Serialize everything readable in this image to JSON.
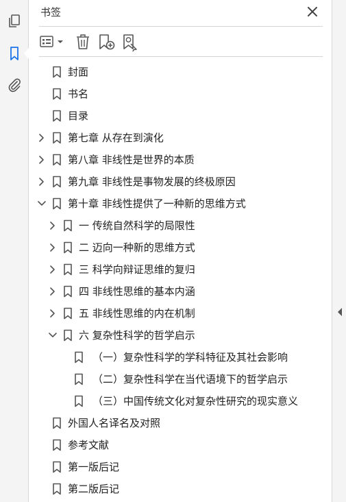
{
  "panel": {
    "title": "书签"
  },
  "rail": {
    "items": [
      {
        "icon": "pages-icon"
      },
      {
        "icon": "bookmark-icon",
        "active": true
      },
      {
        "icon": "attachment-icon"
      }
    ]
  },
  "toolbar": {
    "items": [
      {
        "icon": "options-menu-icon"
      },
      {
        "icon": "trash-icon"
      },
      {
        "icon": "new-bookmark-icon"
      },
      {
        "icon": "find-bookmark-icon"
      }
    ]
  },
  "colors": {
    "icon": "#555555",
    "rail_active": "#1a73e8",
    "text": "#222222"
  },
  "bookmarks": [
    {
      "label": "封面",
      "level": 0,
      "expander": "none"
    },
    {
      "label": "书名",
      "level": 0,
      "expander": "none"
    },
    {
      "label": "目录",
      "level": 0,
      "expander": "none"
    },
    {
      "label": "第七章  从存在到演化",
      "level": 0,
      "expander": "collapsed"
    },
    {
      "label": "第八章  非线性是世界的本质",
      "level": 0,
      "expander": "collapsed"
    },
    {
      "label": "第九章  非线性是事物发展的终极原因",
      "level": 0,
      "expander": "collapsed"
    },
    {
      "label": "第十章  非线性提供了一种新的思维方式",
      "level": 0,
      "expander": "expanded"
    },
    {
      "label": "一  传统自然科学的局限性",
      "level": 1,
      "expander": "collapsed"
    },
    {
      "label": "二  迈向一种新的思维方式",
      "level": 1,
      "expander": "collapsed"
    },
    {
      "label": "三  科学向辩证思维的复归",
      "level": 1,
      "expander": "collapsed"
    },
    {
      "label": "四  非线性思维的基本内涵",
      "level": 1,
      "expander": "collapsed"
    },
    {
      "label": "五  非线性思维的内在机制",
      "level": 1,
      "expander": "collapsed"
    },
    {
      "label": "六  复杂性科学的哲学启示",
      "level": 1,
      "expander": "expanded"
    },
    {
      "label": "（一）复杂性科学的学科特征及其社会影响",
      "level": 2,
      "expander": "none"
    },
    {
      "label": "（二）复杂性科学在当代语境下的哲学启示",
      "level": 2,
      "expander": "none"
    },
    {
      "label": "（三）中国传统文化对复杂性研究的现实意义",
      "level": 2,
      "expander": "none"
    },
    {
      "label": "外国人名译名及对照",
      "level": 0,
      "expander": "none"
    },
    {
      "label": "参考文献",
      "level": 0,
      "expander": "none"
    },
    {
      "label": "第一版后记",
      "level": 0,
      "expander": "none"
    },
    {
      "label": "第二版后记",
      "level": 0,
      "expander": "none"
    }
  ]
}
